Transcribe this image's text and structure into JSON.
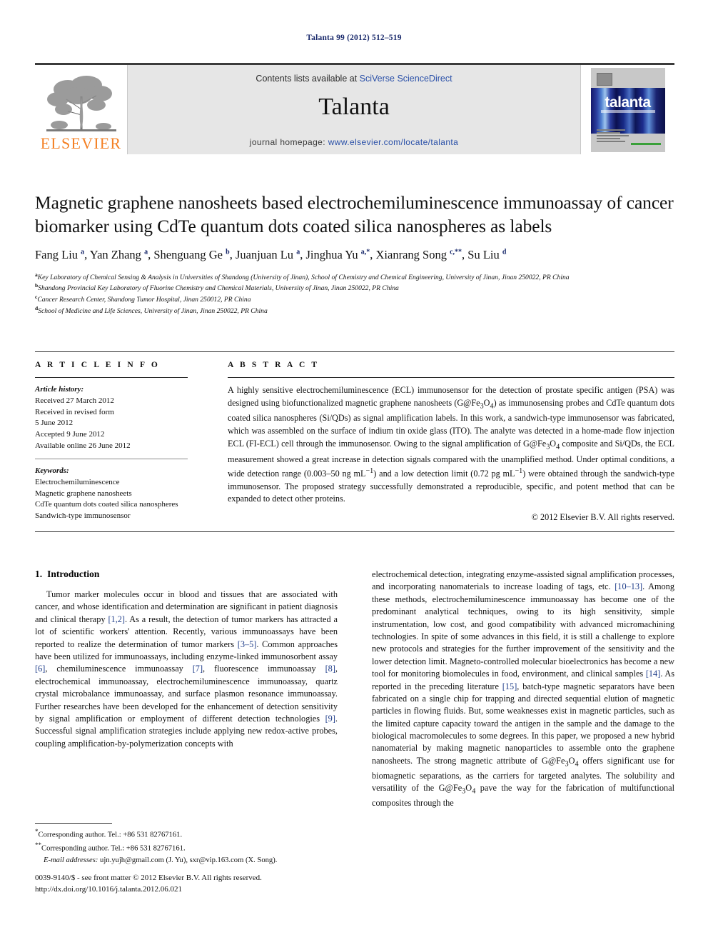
{
  "running_head": "Talanta 99 (2012) 512–519",
  "masthead": {
    "contents_prefix": "Contents lists available at ",
    "sciencedirect": "SciVerse ScienceDirect",
    "journal_title": "Talanta",
    "homepage_prefix": "journal homepage: ",
    "homepage_url": "www.elsevier.com/locate/talanta",
    "publisher_logo_text": "ELSEVIER",
    "cover_title": "talanta",
    "accent_link_color": "#2a50a8",
    "elsevier_orange": "#F48024"
  },
  "article": {
    "title": "Magnetic graphene nanosheets based electrochemiluminescence immunoassay of cancer biomarker using CdTe quantum dots coated silica nanospheres as labels",
    "authors_html": "Fang Liu <sup>a</sup>, Yan Zhang <sup>a</sup>, Shenguang Ge <sup>b</sup>, Juanjuan Lu <sup>a</sup>, Jinghua Yu <sup>a,*</sup>, Xianrang Song <sup>c,**</sup>, Su Liu <sup>d</sup>",
    "affiliations": [
      {
        "mark": "a",
        "text": "Key Laboratory of Chemical Sensing & Analysis in Universities of Shandong (University of Jinan), School of Chemistry and Chemical Engineering, University of Jinan, Jinan 250022, PR China"
      },
      {
        "mark": "b",
        "text": "Shandong Provincial Key Laboratory of Fluorine Chemistry and Chemical Materials, University of Jinan, Jinan 250022, PR China"
      },
      {
        "mark": "c",
        "text": "Cancer Research Center, Shandong Tumor Hospital, Jinan 250012, PR China"
      },
      {
        "mark": "d",
        "text": "School of Medicine and Life Sciences, University of Jinan, Jinan 250022, PR China"
      }
    ]
  },
  "article_info": {
    "heading": "A R T I C L E  I N F O",
    "history_label": "Article history:",
    "history": [
      "Received 27 March 2012",
      "Received in revised form",
      "5 June 2012",
      "Accepted 9 June 2012",
      "Available online 26 June 2012"
    ],
    "keywords_label": "Keywords:",
    "keywords": [
      "Electrochemiluminescence",
      "Magnetic graphene nanosheets",
      "CdTe quantum dots coated silica nanospheres",
      "Sandwich-type immunosensor"
    ]
  },
  "abstract": {
    "heading": "A B S T R A C T",
    "text_html": "A highly sensitive electrochemiluminescence (ECL) immunosensor for the detection of prostate specific antigen (PSA) was designed using biofunctionalized magnetic graphene nanosheets (G@Fe<sub>3</sub>O<sub>4</sub>) as immunosensing probes and CdTe quantum dots coated silica nanospheres (Si/QDs) as signal amplification labels. In this work, a sandwich-type immunosensor was fabricated, which was assembled on the surface of indium tin oxide glass (ITO). The analyte was detected in a home-made flow injection ECL (FI-ECL) cell through the immunosensor. Owing to the signal amplification of G@Fe<sub>3</sub>O<sub>4</sub> composite and Si/QDs, the ECL measurement showed a great increase in detection signals compared with the unamplified method. Under optimal conditions, a wide detection range (0.003–50 ng mL<sup>−1</sup>) and a low detection limit (0.72 pg mL<sup>−1</sup>) were obtained through the sandwich-type immunosensor. The proposed strategy successfully demonstrated a reproducible, specific, and potent method that can be expanded to detect other proteins.",
    "copyright": "© 2012 Elsevier B.V. All rights reserved."
  },
  "introduction": {
    "number": "1.",
    "title": "Introduction",
    "left_paragraph_html": "Tumor marker molecules occur in blood and tissues that are associated with cancer, and whose identification and determination are significant in patient diagnosis and clinical therapy <span class=\"ref\">[1,2]</span>. As a result, the detection of tumor markers has attracted a lot of scientific workers' attention. Recently, various immunoassays have been reported to realize the determination of tumor markers <span class=\"ref\">[3–5]</span>. Common approaches have been utilized for immunoassays, including enzyme-linked immunosorbent assay <span class=\"ref\">[6]</span>, chemiluminescence immunoassay <span class=\"ref\">[7]</span>, fluorescence immunoassay <span class=\"ref\">[8]</span>, electrochemical immunoassay, electrochemiluminescence immunoassay, quartz crystal microbalance immunoassay, and surface plasmon resonance immunoassay. Further researches have been developed for the enhancement of detection sensitivity by signal amplification or employment of different detection technologies <span class=\"ref\">[9]</span>. Successful signal amplification strategies include applying new redox-active probes, coupling amplification-by-polymerization concepts with",
    "right_paragraph_html": "electrochemical detection, integrating enzyme-assisted signal amplification processes, and incorporating nanomaterials to increase loading of tags, etc. <span class=\"ref\">[10–13]</span>. Among these methods, electrochemiluminescence immunoassay has become one of the predominant analytical techniques, owing to its high sensitivity, simple instrumentation, low cost, and good compatibility with advanced micromachining technologies. In spite of some advances in this field, it is still a challenge to explore new protocols and strategies for the further improvement of the sensitivity and the lower detection limit. Magneto-controlled molecular bioelectronics has become a new tool for monitoring biomolecules in food, environment, and clinical samples <span class=\"ref\">[14]</span>. As reported in the preceding literature <span class=\"ref\">[15]</span>, batch-type magnetic separators have been fabricated on a single chip for trapping and directed sequential elution of magnetic particles in flowing fluids. But, some weaknesses exist in magnetic particles, such as the limited capture capacity toward the antigen in the sample and the damage to the biological macromolecules to some degrees. In this paper, we proposed a new hybrid nanomaterial by making magnetic nanoparticles to assemble onto the graphene nanosheets. The strong magnetic attribute of G@Fe<sub>3</sub>O<sub>4</sub> offers significant use for biomagnetic separations, as the carriers for targeted analytes. The solubility and versatility of the G@Fe<sub>3</sub>O<sub>4</sub> pave the way for the fabrication of multifunctional composites through the"
  },
  "footnotes": {
    "line1_html": "<sup>*</sup>Corresponding author. Tel.: +86 531 82767161.",
    "line2_html": "<sup>**</sup>Corresponding author. Tel.: +86 531 82767161.",
    "email_html": "<i>E-mail addresses:</i> ujn.yujh@gmail.com (J. Yu), sxr@vip.163.com (X. Song)."
  },
  "imprint": {
    "line1_html": "0039-9140/$ - see front matter © 2012 Elsevier B.V. All rights reserved.",
    "line2": "http://dx.doi.org/10.1016/j.talanta.2012.06.021"
  }
}
